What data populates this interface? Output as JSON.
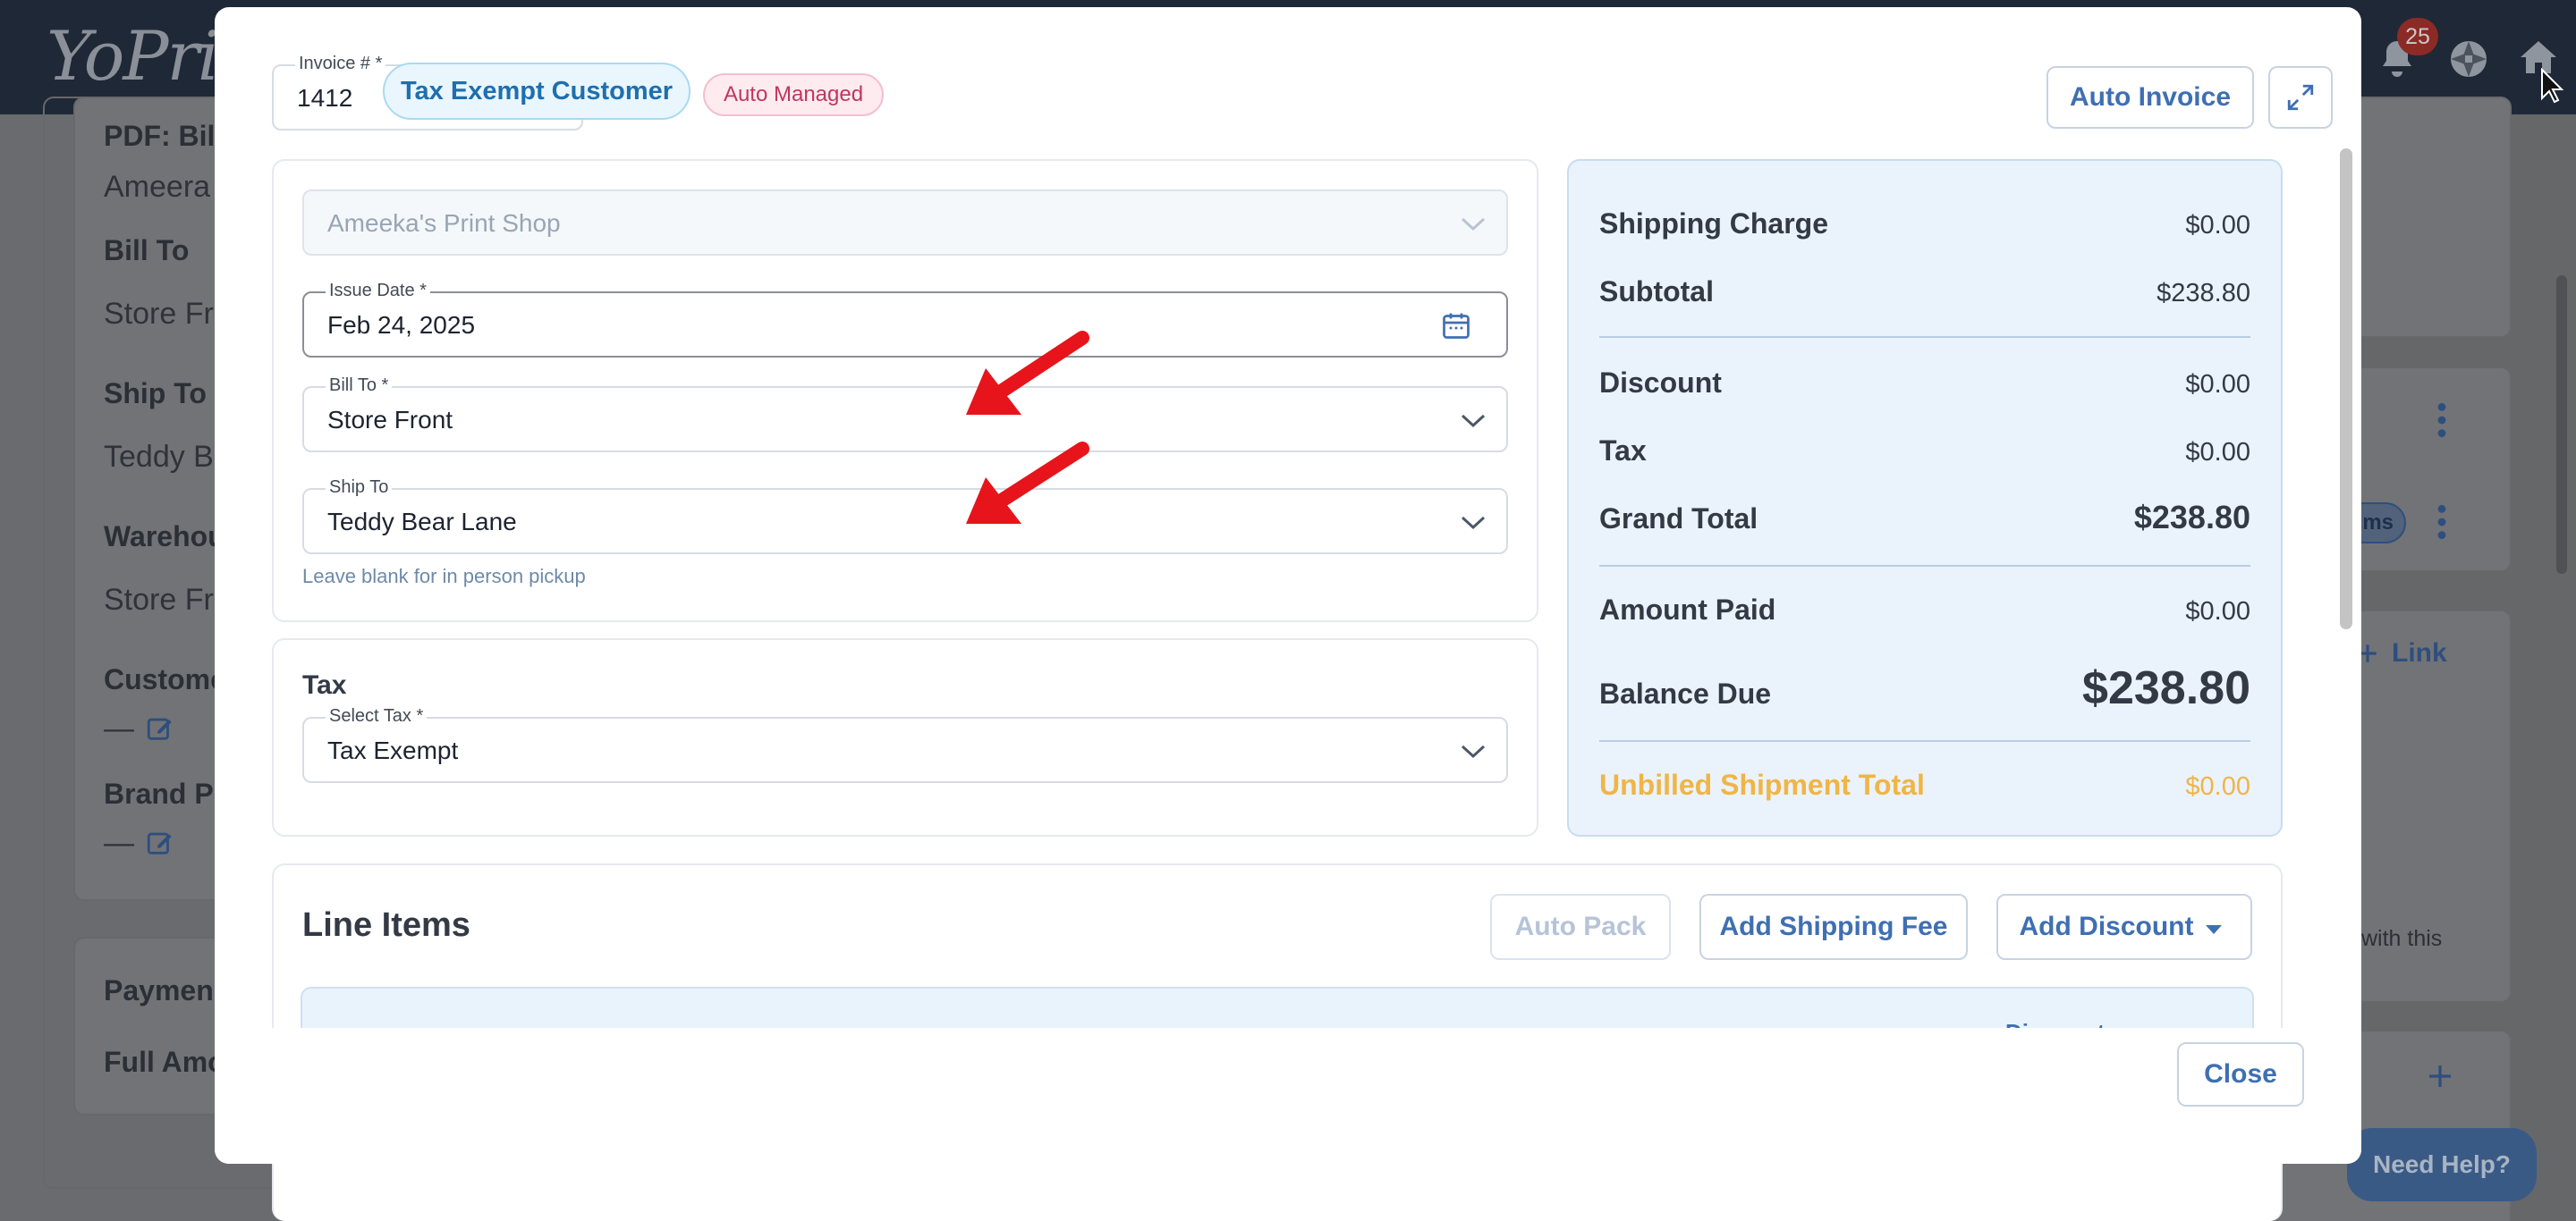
{
  "app": {
    "logo": "YoPrint",
    "notification_count": "25",
    "need_help": "Need Help?"
  },
  "background": {
    "pdf_label": "PDF: Bill",
    "pdf_value": "Ameera",
    "bill_to_label": "Bill To",
    "bill_to_value": "Store Fro",
    "ship_to_label": "Ship To",
    "ship_to_value": "Teddy B",
    "warehouse_label": "Warehou",
    "warehouse_value": "Store Fro",
    "customer_label": "Custome",
    "customer_value": "—",
    "brand_label": "Brand Pr",
    "brand_value": "—",
    "payment_label": "Paymen",
    "full_amount_label": "Full Amo",
    "items_badge": "ms",
    "link_label": "Link",
    "with_this_text": "with this"
  },
  "modal": {
    "invoice_label": "Invoice # *",
    "invoice_value": "1412",
    "tax_exempt_pill": "Tax Exempt Customer",
    "auto_managed_pill": "Auto Managed",
    "auto_invoice_button": "Auto Invoice",
    "customer_placeholder": "Ameeka's Print Shop",
    "issue_date_label": "Issue Date *",
    "issue_date_value": "Feb 24, 2025",
    "bill_to_label": "Bill To *",
    "bill_to_value": "Store Front",
    "ship_to_label": "Ship To",
    "ship_to_value": "Teddy Bear Lane",
    "ship_to_help": "Leave blank for in person pickup",
    "tax_title": "Tax",
    "select_tax_label": "Select Tax *",
    "select_tax_value": "Tax Exempt",
    "line_items_title": "Line Items",
    "auto_pack_button": "Auto Pack",
    "add_shipping_fee_button": "Add Shipping Fee",
    "add_discount_button": "Add Discount",
    "table_head_discount": "Discount",
    "close_button": "Close"
  },
  "totals": {
    "shipping_charge_label": "Shipping Charge",
    "shipping_charge_value": "$0.00",
    "subtotal_label": "Subtotal",
    "subtotal_value": "$238.80",
    "discount_label": "Discount",
    "discount_value": "$0.00",
    "tax_label": "Tax",
    "tax_value": "$0.00",
    "grand_total_label": "Grand Total",
    "grand_total_value": "$238.80",
    "amount_paid_label": "Amount Paid",
    "amount_paid_value": "$0.00",
    "balance_due_label": "Balance Due",
    "balance_due_value": "$238.80",
    "unbilled_label": "Unbilled Shipment Total",
    "unbilled_value": "$0.00"
  },
  "colors": {
    "accent": "#3f6fb3",
    "unbilled": "#f0b545",
    "annotation_arrow": "#e8141b",
    "topbar": "#1f2836"
  },
  "icons": [
    "bell-icon",
    "aperture-icon",
    "home-icon",
    "calendar-icon",
    "expand-icon",
    "chevron-down-icon",
    "edit-icon",
    "kebab-menu-icon",
    "plus-icon"
  ]
}
